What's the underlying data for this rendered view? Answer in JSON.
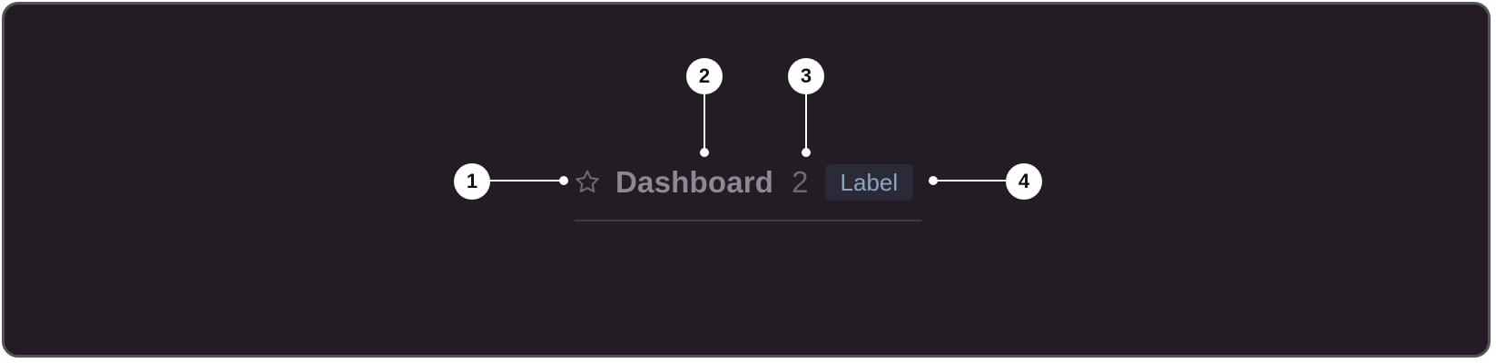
{
  "tab": {
    "icon": "star-icon",
    "title": "Dashboard",
    "count": "2",
    "label": "Label"
  },
  "callouts": [
    "1",
    "2",
    "3",
    "4"
  ],
  "colors": {
    "background": "#231c24",
    "border": "#57505a",
    "title": "#8f8793",
    "count": "#6f6874",
    "label_bg": "#2b2a38",
    "label_text": "#8fa5bf",
    "callout": "#ffffff"
  }
}
